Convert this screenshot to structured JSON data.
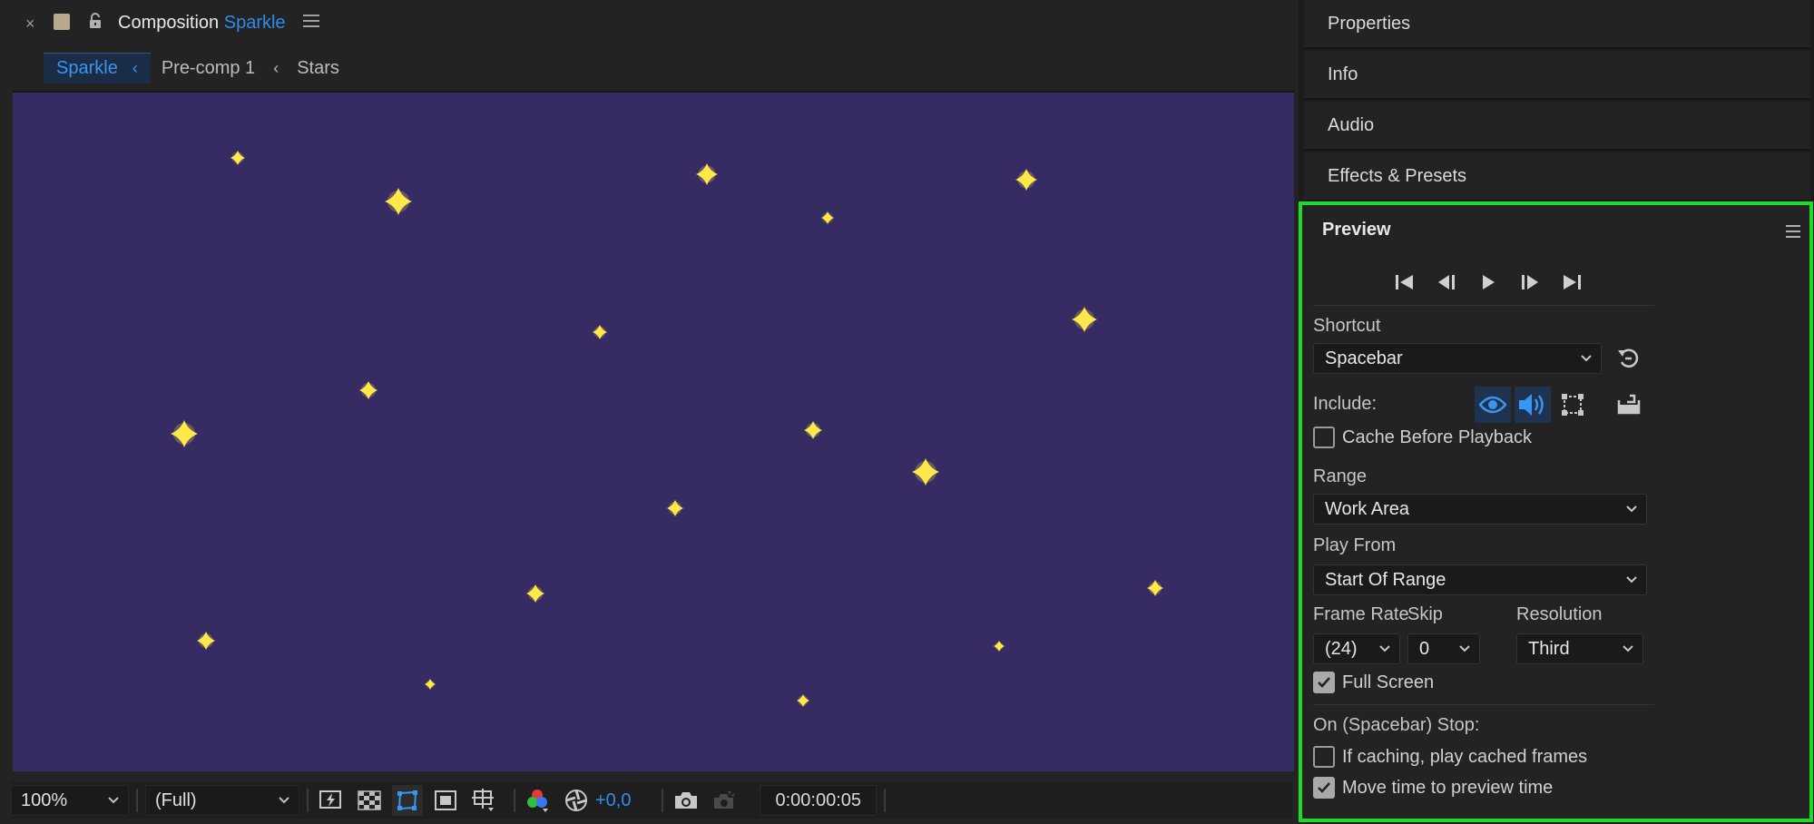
{
  "composition": {
    "close_glyph": "×",
    "title_prefix": "Composition",
    "title_name": "Sparkle",
    "breadcrumbs": [
      {
        "label": "Sparkle",
        "active": true
      },
      {
        "label": "Pre-comp 1",
        "active": false
      },
      {
        "label": "Stars",
        "active": false
      }
    ],
    "breadcrumb_separator": "‹",
    "background_color": "#362b62",
    "star_color": "#ffe94a"
  },
  "viewer_footer": {
    "zoom": "100%",
    "resolution": "(Full)",
    "exposure": "+0,0",
    "timecode": "0:00:00:05"
  },
  "dock": {
    "tabs": [
      "Properties",
      "Info",
      "Audio",
      "Effects & Presets"
    ]
  },
  "preview": {
    "title": "Preview",
    "shortcut_label": "Shortcut",
    "shortcut_value": "Spacebar",
    "include_label": "Include:",
    "cache_before_playback_label": "Cache Before Playback",
    "cache_before_playback_checked": false,
    "range_label": "Range",
    "range_value": "Work Area",
    "play_from_label": "Play From",
    "play_from_value": "Start Of Range",
    "frame_rate_label": "Frame Rate",
    "frame_rate_value": "(24)",
    "skip_label": "Skip",
    "skip_value": "0",
    "resolution_label": "Resolution",
    "resolution_value": "Third",
    "full_screen_label": "Full Screen",
    "full_screen_checked": true,
    "stop_label": "On (Spacebar) Stop:",
    "if_caching_label": "If caching, play cached frames",
    "if_caching_checked": false,
    "move_time_label": "Move time to preview time",
    "move_time_checked": true,
    "highlight_color": "#1bdc27"
  }
}
